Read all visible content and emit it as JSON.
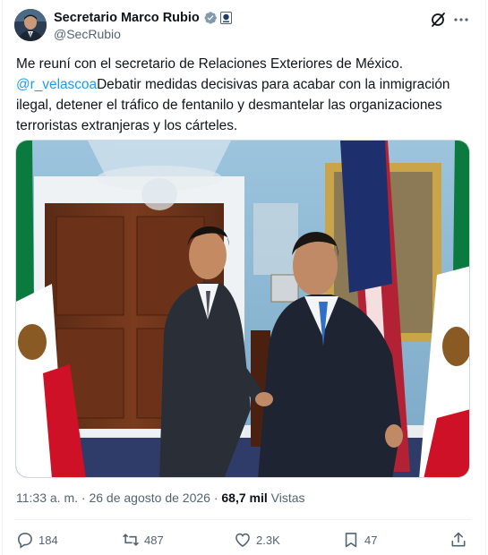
{
  "author": {
    "display_name": "Secretario Marco Rubio",
    "handle": "@SecRubio",
    "avatar_icon": "avatar-portrait",
    "verified_color": "#829aab"
  },
  "tweet": {
    "text_line_1": "Me reuní con el secretario de Relaciones Exteriores de México.",
    "mention": "@r_velascoa",
    "text_rest": "Debatir medidas decisivas para acabar con la inmigración ilegal, detener el tráfico de fentanilo y desmantelar las organizaciones terroristas extranjeras y los cárteles.",
    "time": "11:33 a. m.",
    "separator": "·",
    "date": "26 de agosto de 2026",
    "views_count": "68,7 mil",
    "views_label": "Vistas"
  },
  "actions": {
    "replies": "184",
    "reposts": "487",
    "likes": "2.3K",
    "bookmarks": "47"
  },
  "colors": {
    "accent": "#1d9bf0",
    "secondary_text": "#536471",
    "wall": "#8fb9d2"
  }
}
